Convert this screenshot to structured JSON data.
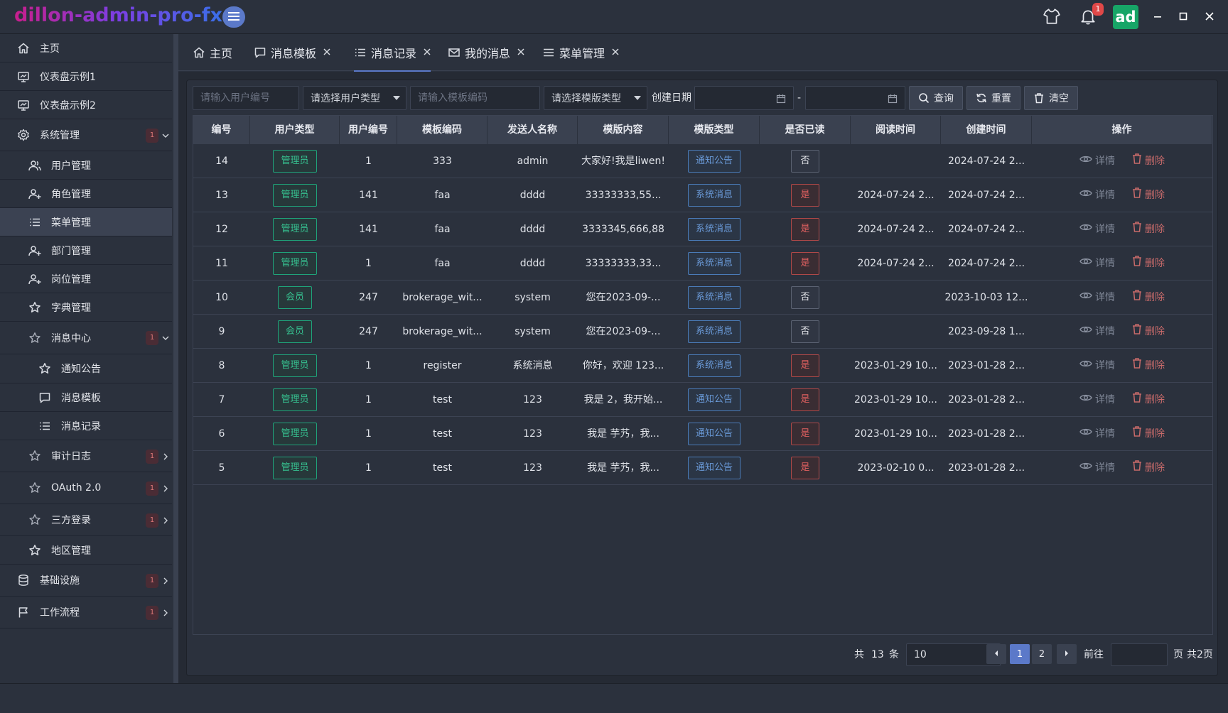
{
  "header": {
    "brand": "dillon-admin-pro-fx",
    "notification_count": "1",
    "avatar": "ad"
  },
  "sidebar": {
    "items": [
      {
        "label": "主页",
        "icon": "home-icon"
      },
      {
        "label": "仪表盘示例1",
        "icon": "dashboard-icon"
      },
      {
        "label": "仪表盘示例2",
        "icon": "dashboard-icon"
      },
      {
        "label": "系统管理",
        "icon": "gear-icon",
        "badge": "1"
      },
      {
        "label": "用户管理",
        "icon": "users-icon"
      },
      {
        "label": "角色管理",
        "icon": "user-add-icon"
      },
      {
        "label": "菜单管理",
        "icon": "list-icon",
        "active": true
      },
      {
        "label": "部门管理",
        "icon": "user-add-icon"
      },
      {
        "label": "岗位管理",
        "icon": "user-add-icon"
      },
      {
        "label": "字典管理",
        "icon": "star-icon"
      },
      {
        "label": "消息中心",
        "icon": "star-outline-icon",
        "badge": "1"
      },
      {
        "label": "通知公告",
        "icon": "star-icon"
      },
      {
        "label": "消息模板",
        "icon": "message-icon"
      },
      {
        "label": "消息记录",
        "icon": "list-icon"
      },
      {
        "label": "审计日志",
        "icon": "star-outline-icon",
        "badge": "1"
      },
      {
        "label": "OAuth 2.0",
        "icon": "star-outline-icon",
        "badge": "1"
      },
      {
        "label": "三方登录",
        "icon": "star-outline-icon",
        "badge": "1"
      },
      {
        "label": "地区管理",
        "icon": "star-icon"
      },
      {
        "label": "基础设施",
        "icon": "database-icon",
        "badge": "1"
      },
      {
        "label": "工作流程",
        "icon": "flag-icon",
        "badge": "1"
      }
    ]
  },
  "tabs": [
    {
      "label": "主页",
      "icon": "home-icon",
      "closable": false
    },
    {
      "label": "消息模板",
      "icon": "message-icon",
      "closable": true
    },
    {
      "label": "消息记录",
      "icon": "list-icon",
      "closable": true,
      "active": true
    },
    {
      "label": "我的消息",
      "icon": "mail-icon",
      "closable": true
    },
    {
      "label": "菜单管理",
      "icon": "menu-icon",
      "closable": true
    }
  ],
  "filters": {
    "user_id_placeholder": "请输入用户编号",
    "user_type_select": "请选择用户类型",
    "template_code_placeholder": "请输入模板编码",
    "template_type_select": "请选择模版类型",
    "created_date_label": "创建日期",
    "date_separator": "-",
    "query_label": "查询",
    "reset_label": "重置",
    "clear_label": "清空"
  },
  "table": {
    "columns": [
      "编号",
      "用户类型",
      "用户编号",
      "模板编码",
      "发送人名称",
      "模版内容",
      "模版类型",
      "是否已读",
      "阅读时间",
      "创建时间",
      "操作"
    ],
    "detail_label": "详情",
    "delete_label": "删除",
    "rows": [
      {
        "id": "14",
        "user_type": "管理员",
        "user_id": "1",
        "code": "333",
        "sender": "admin",
        "content": "大家好!我是liwen!",
        "type": "通知公告",
        "read": "否",
        "read_time": "",
        "created": "2024-07-24 2..."
      },
      {
        "id": "13",
        "user_type": "管理员",
        "user_id": "141",
        "code": "faa",
        "sender": "dddd",
        "content": "33333333,55...",
        "type": "系统消息",
        "read": "是",
        "read_time": "2024-07-24 2...",
        "created": "2024-07-24 2..."
      },
      {
        "id": "12",
        "user_type": "管理员",
        "user_id": "141",
        "code": "faa",
        "sender": "dddd",
        "content": "3333345,666,88",
        "type": "系统消息",
        "read": "是",
        "read_time": "2024-07-24 2...",
        "created": "2024-07-24 2..."
      },
      {
        "id": "11",
        "user_type": "管理员",
        "user_id": "1",
        "code": "faa",
        "sender": "dddd",
        "content": "33333333,33...",
        "type": "系统消息",
        "read": "是",
        "read_time": "2024-07-24 2...",
        "created": "2024-07-24 2..."
      },
      {
        "id": "10",
        "user_type": "会员",
        "user_id": "247",
        "code": "brokerage_wit...",
        "sender": "system",
        "content": "您在2023-09-...",
        "type": "系统消息",
        "read": "否",
        "read_time": "",
        "created": "2023-10-03 12..."
      },
      {
        "id": "9",
        "user_type": "会员",
        "user_id": "247",
        "code": "brokerage_wit...",
        "sender": "system",
        "content": "您在2023-09-...",
        "type": "系统消息",
        "read": "否",
        "read_time": "",
        "created": "2023-09-28 1..."
      },
      {
        "id": "8",
        "user_type": "管理员",
        "user_id": "1",
        "code": "register",
        "sender": "系统消息",
        "content": "你好，欢迎 123...",
        "type": "系统消息",
        "read": "是",
        "read_time": "2023-01-29 10...",
        "created": "2023-01-28 2..."
      },
      {
        "id": "7",
        "user_type": "管理员",
        "user_id": "1",
        "code": "test",
        "sender": "123",
        "content": "我是 2，我开始...",
        "type": "通知公告",
        "read": "是",
        "read_time": "2023-01-29 10...",
        "created": "2023-01-28 2..."
      },
      {
        "id": "6",
        "user_type": "管理员",
        "user_id": "1",
        "code": "test",
        "sender": "123",
        "content": "我是 芋艿，我...",
        "type": "通知公告",
        "read": "是",
        "read_time": "2023-01-29 10...",
        "created": "2023-01-28 2..."
      },
      {
        "id": "5",
        "user_type": "管理员",
        "user_id": "1",
        "code": "test",
        "sender": "123",
        "content": "我是 芋艿，我...",
        "type": "通知公告",
        "read": "是",
        "read_time": "2023-02-10 0...",
        "created": "2023-01-28 2..."
      }
    ]
  },
  "pagination": {
    "total_prefix": "共",
    "total": "13",
    "total_suffix": "条",
    "page_size": "10",
    "pages": [
      "1",
      "2"
    ],
    "current_page": "1",
    "goto_label": "前往",
    "goto_value": "",
    "page_suffix": "页",
    "page_count_label": "共2页"
  },
  "colors": {
    "accent": "#5b79c9",
    "tag_green": "#36c08f",
    "tag_blue": "#6a9ad8",
    "tag_red": "#e06060",
    "avatar_bg": "#17a567"
  }
}
